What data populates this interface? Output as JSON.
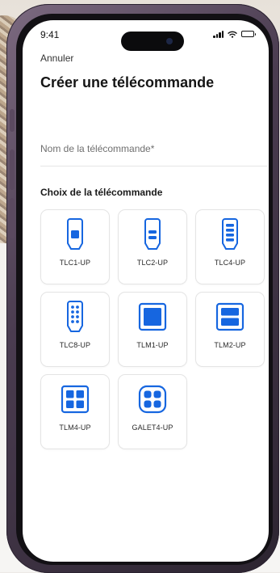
{
  "status": {
    "time": "9:41"
  },
  "header": {
    "cancel_label": "Annuler",
    "title": "Créer une télécommande"
  },
  "form": {
    "name_placeholder": "Nom de la télécommande*"
  },
  "section": {
    "label": "Choix de la télécommande"
  },
  "colors": {
    "accent": "#1666e0",
    "text": "#151515"
  },
  "remotes": [
    {
      "label": "TLC1-UP",
      "icon": "remote-1-button-icon"
    },
    {
      "label": "TLC2-UP",
      "icon": "remote-2-button-icon"
    },
    {
      "label": "TLC4-UP",
      "icon": "remote-4-button-icon"
    },
    {
      "label": "TLC8-UP",
      "icon": "remote-8-button-icon"
    },
    {
      "label": "TLM1-UP",
      "icon": "wall-switch-1-icon"
    },
    {
      "label": "TLM2-UP",
      "icon": "wall-switch-2-icon"
    },
    {
      "label": "TLM4-UP",
      "icon": "wall-switch-4-icon"
    },
    {
      "label": "GALET4-UP",
      "icon": "galet-4-button-icon"
    }
  ]
}
